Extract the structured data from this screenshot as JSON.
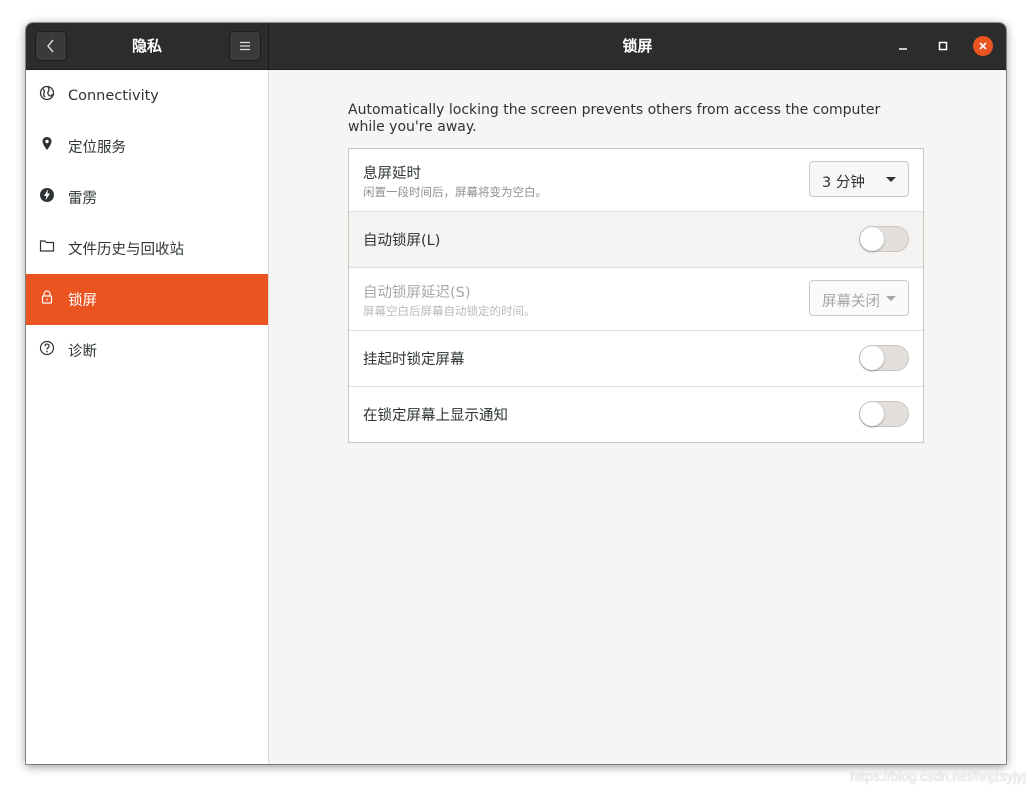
{
  "window": {
    "sidebar_title": "隐私",
    "main_title": "锁屏"
  },
  "sidebar": {
    "items": [
      {
        "label": "Connectivity",
        "icon": "globe-icon"
      },
      {
        "label": "定位服务",
        "icon": "location-pin-icon"
      },
      {
        "label": "雷雳",
        "icon": "thunderbolt-icon"
      },
      {
        "label": "文件历史与回收站",
        "icon": "folder-icon"
      },
      {
        "label": "锁屏",
        "icon": "lock-icon",
        "active": true
      },
      {
        "label": "诊断",
        "icon": "question-icon"
      }
    ]
  },
  "content": {
    "description": "Automatically locking the screen prevents others from access the computer while you're away.",
    "rows": [
      {
        "title": "息屏延时",
        "subtitle": "闲置一段时间后，屏幕将变为空白。",
        "control": "combo",
        "value": "3 分钟"
      },
      {
        "title": "自动锁屏(L)",
        "control": "toggle",
        "state": "off"
      },
      {
        "title": "自动锁屏延迟(S)",
        "subtitle": "屏幕空白后屏幕自动锁定的时间。",
        "control": "combo",
        "value": "屏幕关闭",
        "disabled": true
      },
      {
        "title": "挂起时锁定屏幕",
        "control": "toggle",
        "state": "off"
      },
      {
        "title": "在锁定屏幕上显示通知",
        "control": "toggle",
        "state": "off"
      }
    ]
  },
  "colors": {
    "accent": "#e95420",
    "headerbar": "#2c2c2c"
  },
  "watermark": "https://blog.csdn.net/hnjzsyjyj"
}
